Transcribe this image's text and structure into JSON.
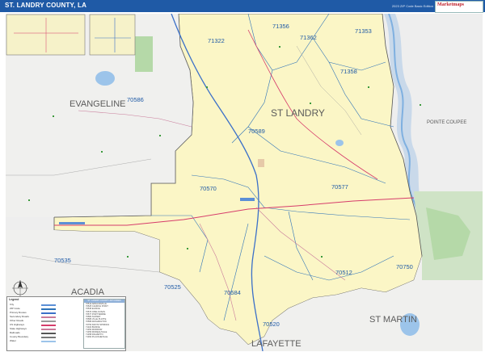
{
  "header": {
    "title": "ST. LANDRY COUNTY, LA",
    "edition": "2023 ZIP Code Basic Edition"
  },
  "brand": {
    "logo_text": "Marketmaps",
    "logo_sub": "MAPS"
  },
  "colors": {
    "county_fill": "#fbf6c6",
    "outside_fill": "#eeeeee",
    "water": "#9cc4ea",
    "interstate": "#3b70c8",
    "highway": "#d63c6b",
    "zip_boundary": "#2e73b8",
    "forest": "#b5d9a8"
  },
  "map": {
    "parishes": [
      {
        "name": "EVANGELINE"
      },
      {
        "name": "ST LANDRY"
      },
      {
        "name": "POINTE COUPEE"
      },
      {
        "name": "ACADIA"
      },
      {
        "name": "LAFAYETTE"
      },
      {
        "name": "ST MARTIN"
      }
    ],
    "zip_codes": [
      "71322",
      "71356",
      "71362",
      "71353",
      "71358",
      "70586",
      "70589",
      "70570",
      "70577",
      "70535",
      "70525",
      "70584",
      "70520",
      "70512",
      "70750"
    ]
  },
  "legend": {
    "title": "Legend",
    "rows": [
      "City",
      "ZIP Code",
      "Primary Routes",
      "Secondary Roads",
      "Other Roads",
      "US Highways",
      "State Highways",
      "Railroads",
      "County Boundary",
      "Water"
    ],
    "zip_table": {
      "title": "ST. LANDRY COUNTY ZIP CODES",
      "rows": [
        "70512 ARNAUDVILLE",
        "70525 CHURCH POINT",
        "70535 EUNICE",
        "70570 OPELOUSAS",
        "70577 PORT BARRE",
        "70584 SUNSET",
        "70586 VILLE PLATTE",
        "70589 WASHINGTON",
        "70750 KROTZ SPRINGS",
        "71322 BUNKIE",
        "71353 MORROW",
        "71356 MOREAUVILLE",
        "71358 PALMETTO",
        "71362 PLAUCHEVILLE"
      ]
    }
  }
}
